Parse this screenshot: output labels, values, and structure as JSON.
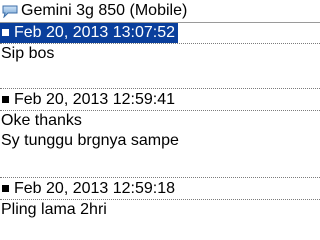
{
  "header": {
    "title": "Gemini 3g 850 (Mobile)",
    "icon": "chat-icon"
  },
  "messages": [
    {
      "timestamp": "Feb 20, 2013 13:07:52",
      "selected": true,
      "lines": [
        "Sip bos"
      ]
    },
    {
      "timestamp": "Feb 20, 2013 12:59:41",
      "selected": false,
      "lines": [
        "Oke thanks",
        "Sy tunggu brgnya sampe"
      ]
    },
    {
      "timestamp": "Feb 20, 2013 12:59:18",
      "selected": false,
      "lines": [
        "Pling lama 2hri"
      ]
    }
  ],
  "colors": {
    "selection": "#0a3f9c",
    "background": "#ffffff"
  }
}
